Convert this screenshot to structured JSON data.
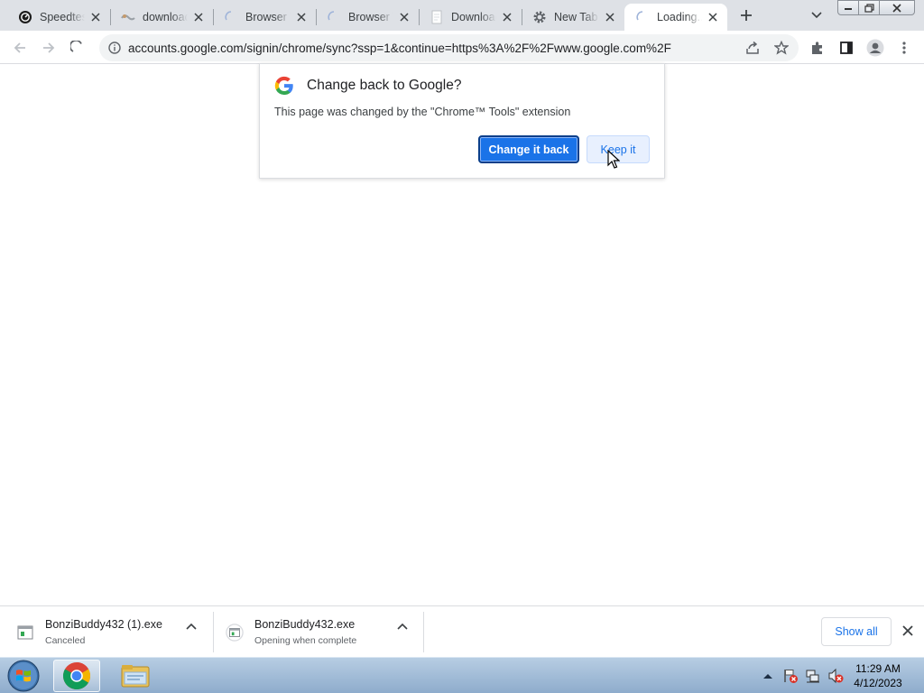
{
  "tabs": [
    {
      "title": "Speedtest",
      "icon": "speedtest-icon"
    },
    {
      "title": "download",
      "icon": "download-site-icon"
    },
    {
      "title": "Browser T",
      "icon": "loading-spinner-icon"
    },
    {
      "title": "Browser T",
      "icon": "loading-spinner-icon"
    },
    {
      "title": "Download",
      "icon": "page-icon"
    },
    {
      "title": "New Tab",
      "icon": "gear-icon"
    },
    {
      "title": "Loading...",
      "icon": "loading-spinner-icon",
      "active": true
    }
  ],
  "toolbar": {
    "url": "accounts.google.com/signin/chrome/sync?ssp=1&continue=https%3A%2F%2Fwww.google.com%2F"
  },
  "popup": {
    "title": "Change back to Google?",
    "body": "This page was changed by the \"Chrome™ Tools\" extension",
    "primary_button": "Change it back",
    "secondary_button": "Keep it"
  },
  "downloads": [
    {
      "name": "BonziBuddy432 (1).exe",
      "status": "Canceled"
    },
    {
      "name": "BonziBuddy432.exe",
      "status": "Opening when complete"
    }
  ],
  "shelf": {
    "show_all": "Show all"
  },
  "clock": {
    "time": "11:29 AM",
    "date": "4/12/2023"
  },
  "colors": {
    "accent": "#1a73e8",
    "tabstrip": "#dee1e6",
    "omnibox": "#f1f3f4"
  }
}
